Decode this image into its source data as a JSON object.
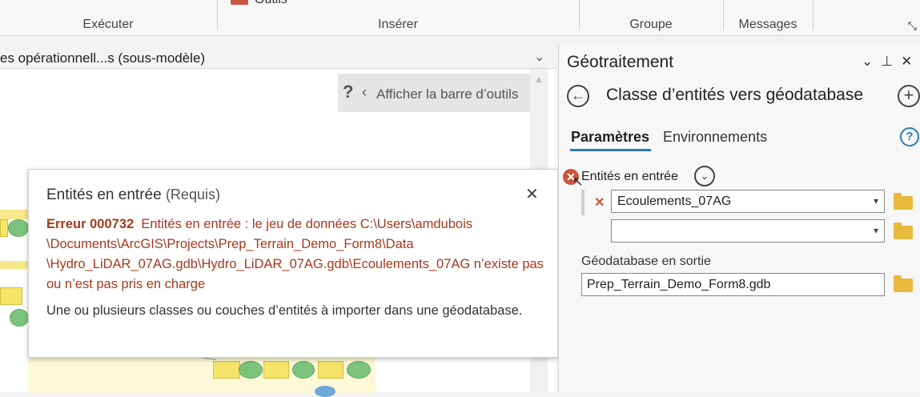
{
  "ribbon": {
    "groups": [
      {
        "label": "Exécuter"
      },
      {
        "label": "Insérer"
      },
      {
        "label": "Groupe"
      },
      {
        "label": "Messages"
      }
    ],
    "outils_label": "Outils"
  },
  "model_view": {
    "title": "es opérationnell...s (sous-modèle)",
    "toolbar_help": "?",
    "toolbar_label": "Afficher la barre d’outils"
  },
  "popup": {
    "title": "Entités en entrée",
    "required": "(Requis)",
    "error_code": "Erreur 000732",
    "error_message": "Entités en entrée : le jeu de données C:\\Users\\amdubois \\Documents\\ArcGIS\\Projects\\Prep_Terrain_Demo_Form8\\Data \\Hydro_LiDAR_07AG.gdb\\Hydro_LiDAR_07AG.gdb\\Ecoulements_07AG n’existe pas ou n’est pas pris en charge",
    "description": "Une ou plusieurs classes ou couches d’entités à importer dans une géodatabase."
  },
  "geoprocessing": {
    "title": "Géotraitement",
    "tool_name": "Classe d’entités vers géodatabase",
    "tabs": [
      {
        "label": "Paramètres",
        "active": true
      },
      {
        "label": "Environnements",
        "active": false
      }
    ],
    "input_label": "Entités en entrée",
    "input_values": [
      "Ecoulements_07AG",
      ""
    ],
    "output_label": "Géodatabase en sortie",
    "output_value": "Prep_Terrain_Demo_Form8.gdb"
  },
  "colors": {
    "accent": "#2b7bb9",
    "error": "#a33a1e",
    "error_icon": "#c8553d",
    "folder": "#e8b93a"
  }
}
